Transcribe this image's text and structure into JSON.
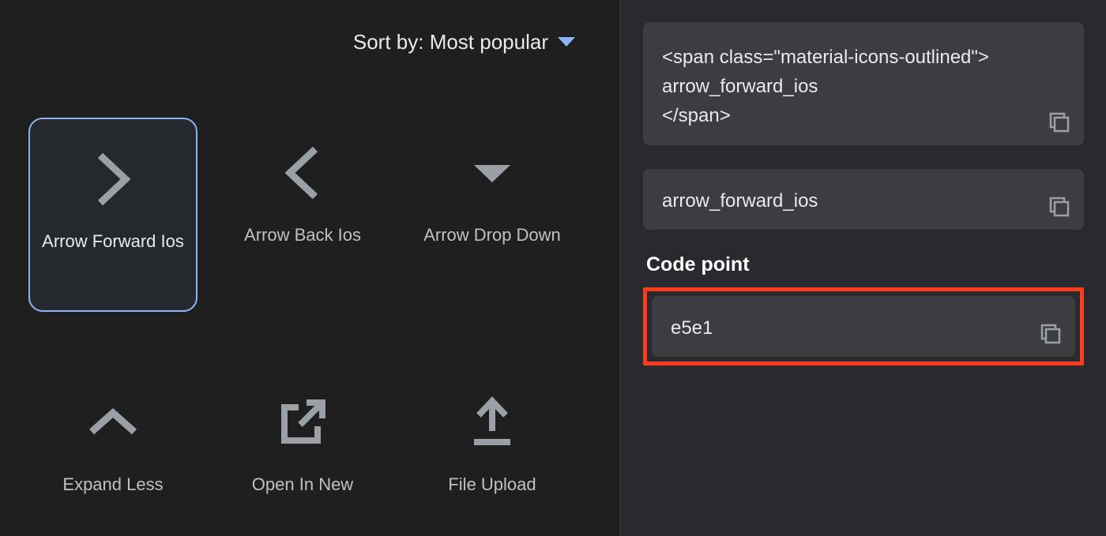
{
  "sort": {
    "label": "Sort by:",
    "value": "Most popular"
  },
  "icons": [
    {
      "id": "arrow-forward-ios",
      "label": "Arrow Forward Ios",
      "selected": true
    },
    {
      "id": "arrow-back-ios",
      "label": "Arrow Back Ios",
      "selected": false
    },
    {
      "id": "arrow-drop-down",
      "label": "Arrow Drop Down",
      "selected": false
    },
    {
      "id": "expand-less",
      "label": "Expand Less",
      "selected": false
    },
    {
      "id": "open-in-new",
      "label": "Open In New",
      "selected": false
    },
    {
      "id": "file-upload",
      "label": "File Upload",
      "selected": false
    }
  ],
  "detail": {
    "snippet_html": "<span class=\"material-icons-outlined\">\narrow_forward_ios\n</span>",
    "icon_name": "arrow_forward_ios",
    "code_point_label": "Code point",
    "code_point": "e5e1"
  }
}
